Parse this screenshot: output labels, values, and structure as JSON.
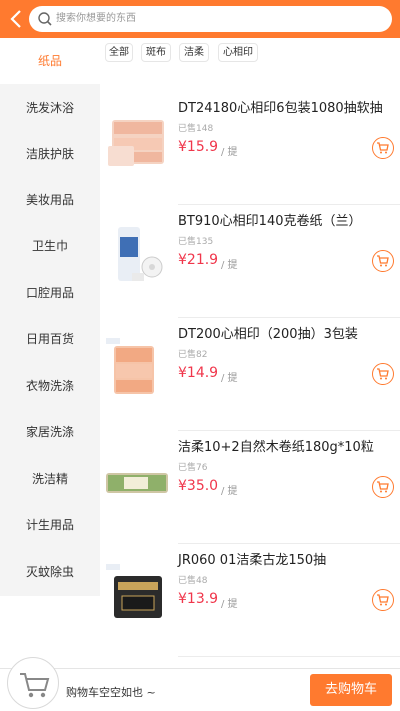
{
  "header": {
    "search_placeholder": "搜索你想要的东西"
  },
  "sidebar": {
    "items": [
      {
        "label": "纸品",
        "active": true
      },
      {
        "label": "洗发沐浴"
      },
      {
        "label": "洁肤护肤"
      },
      {
        "label": "美妆用品"
      },
      {
        "label": "卫生巾"
      },
      {
        "label": "口腔用品"
      },
      {
        "label": "日用百货"
      },
      {
        "label": "衣物洗涤"
      },
      {
        "label": "家居洗涤"
      },
      {
        "label": "洗洁精"
      },
      {
        "label": "计生用品"
      },
      {
        "label": "灭蚊除虫"
      }
    ]
  },
  "filters": {
    "tags": [
      "全部",
      "斑布",
      "洁柔",
      "心相印"
    ]
  },
  "products": [
    {
      "name": "DT24180心相印6包装1080抽软抽",
      "sold": "已售148",
      "price": "¥15.9",
      "unit": "/ 提"
    },
    {
      "name": "BT910心相印140克卷纸（兰）",
      "sold": "已售135",
      "price": "¥21.9",
      "unit": "/ 提"
    },
    {
      "name": "DT200心相印（200抽）3包装",
      "sold": "已售82",
      "price": "¥14.9",
      "unit": "/ 提"
    },
    {
      "name": "洁柔10+2自然木卷纸180g*10粒",
      "sold": "已售76",
      "price": "¥35.0",
      "unit": "/ 提"
    },
    {
      "name": "JR060 01洁柔古龙150抽",
      "sold": "已售48",
      "price": "¥13.9",
      "unit": "/ 提"
    }
  ],
  "cart": {
    "empty_text": "购物车空空如也 ~",
    "go_label": "去购物车"
  },
  "colors": {
    "accent": "#ff7a2f",
    "price": "#f0364b"
  },
  "icons": {
    "back": "back-arrow-icon",
    "search": "search-icon",
    "add_to_cart": "cart-icon"
  }
}
